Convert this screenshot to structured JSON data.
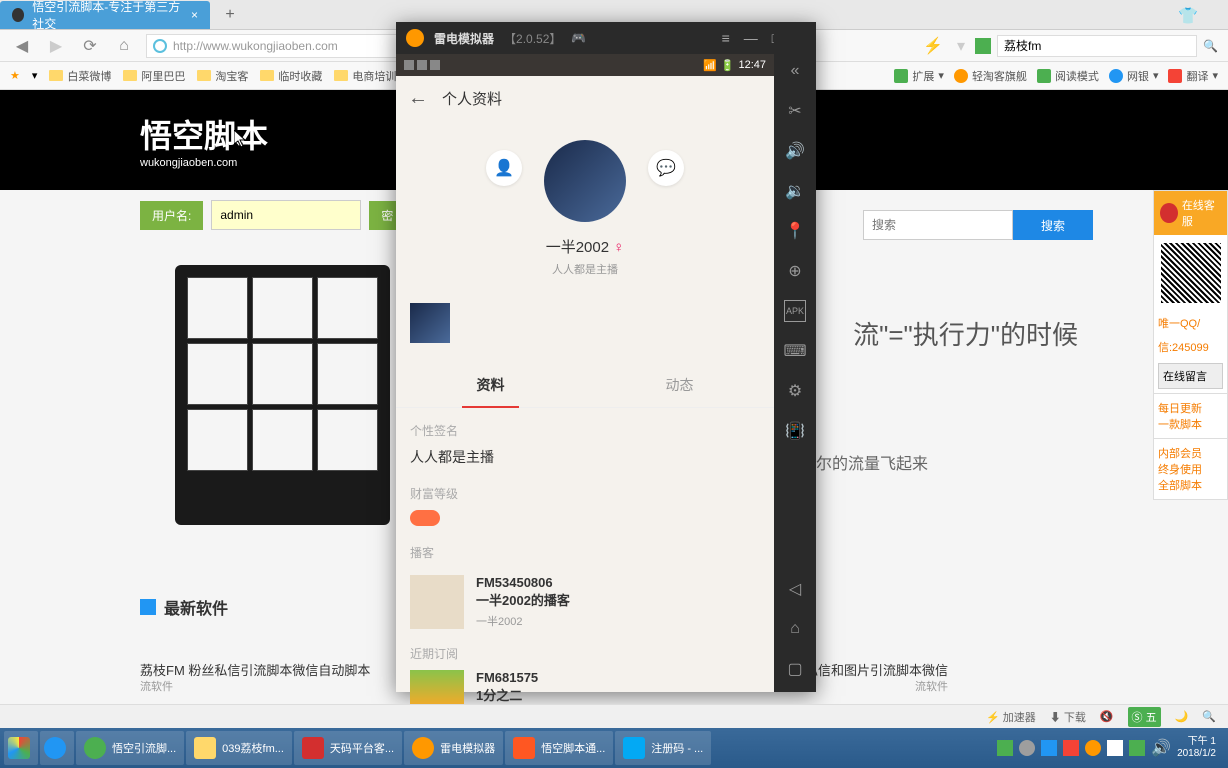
{
  "browser": {
    "tab_title": "悟空引流脚本-专注于第三方社交",
    "url": "http://www.wukongjiaoben.com",
    "search_engine": "荔枝fm",
    "bookmarks": [
      "白菜微博",
      "阿里巴巴",
      "淘宝客",
      "临时收藏",
      "电商培训"
    ],
    "extensions": {
      "ext": "扩展",
      "qtk": "轻淘客旗舰",
      "read": "阅读模式",
      "bank": "网银",
      "trans": "翻译"
    },
    "status": {
      "accel": "加速器",
      "download": "下载",
      "ime": "五"
    }
  },
  "page": {
    "logo": "悟空脚本",
    "logo_sub": "wukongjiaoben.com",
    "username_label": "用户名:",
    "username_value": "admin",
    "pass_label": "密",
    "search_placeholder": "搜索",
    "search_btn": "搜索",
    "promo1": "流\"=\"执行力\"的时候",
    "promo2": "尔的流量飞起来",
    "section": "最新软件",
    "news1": "荔枝FM 粉丝私信引流脚本微信自动脚本",
    "news1b": "流软件",
    "news2": "传app自动精准私信和图片引流脚本微信",
    "news2b": "流软件"
  },
  "sidebar": {
    "cs": "在线客服",
    "qq": "唯一QQ/",
    "qq2": "信:245099",
    "msg": "在线留言",
    "b1": "每日更新",
    "b2": "一款脚本",
    "b3": "内部会员",
    "b4": "终身使用",
    "b5": "全部脚本"
  },
  "emulator": {
    "title": "雷电模拟器",
    "version": "【2.0.52】",
    "android_time": "12:47",
    "app": {
      "title": "个人资料",
      "username": "一半2002",
      "bio": "人人都是主播",
      "tab1": "资料",
      "tab2": "动态",
      "sig_label": "个性签名",
      "sig_value": "人人都是主播",
      "wealth_label": "财富等级",
      "podcast_label": "播客",
      "fm_id": "FM53450806",
      "fm_name": "一半2002的播客",
      "fm_sub": "一半2002",
      "sub_label": "近期订阅",
      "fm2_id": "FM681575",
      "fm2_name": "1分之二"
    }
  },
  "taskbar": {
    "items": [
      "悟空引流脚...",
      "039荔枝fm...",
      "天码平台客...",
      "雷电模拟器",
      "悟空脚本通...",
      "注册码 - ..."
    ],
    "time": "下午 1",
    "date": "2018/1/2"
  }
}
